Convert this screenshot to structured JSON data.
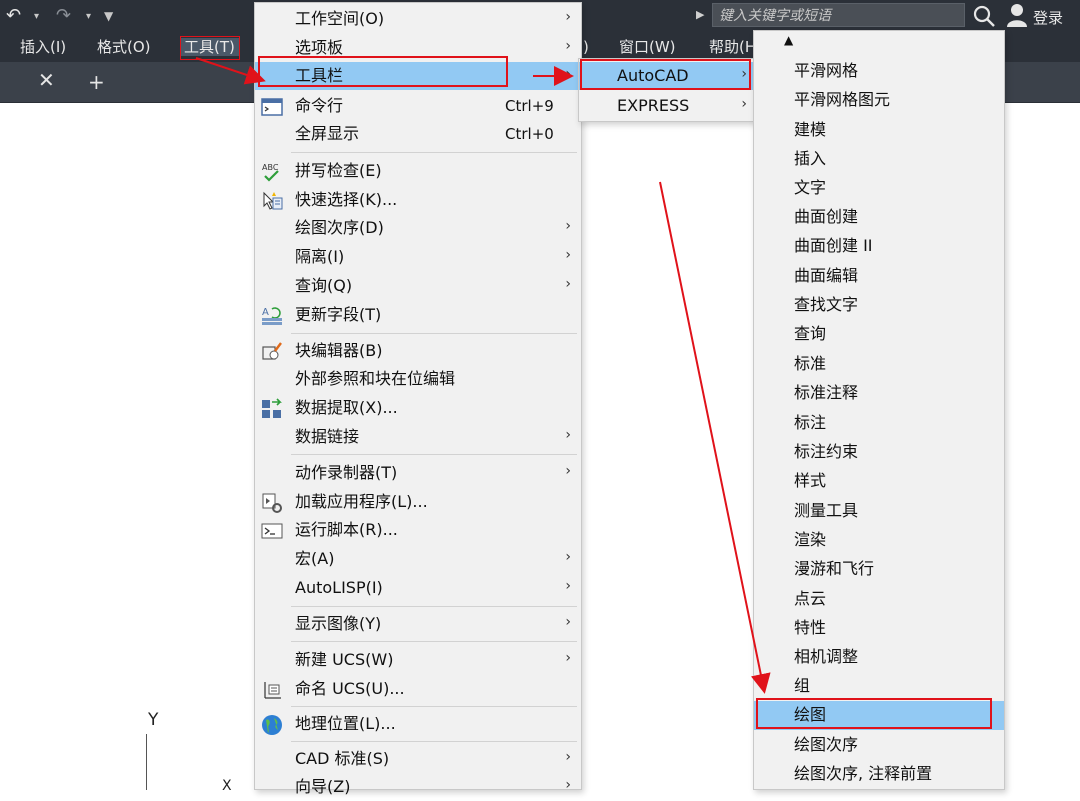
{
  "menubar": {
    "items": [
      "插入(I)",
      "格式(O)",
      "工具(T)",
      ")",
      "窗口(W)",
      "帮助(H"
    ]
  },
  "search": {
    "placeholder": "键入关键字或短语"
  },
  "login_label": "登录",
  "tools_menu": {
    "items": [
      {
        "label": "工作空间(O)",
        "submenu": true
      },
      {
        "label": "选项板",
        "submenu": true
      },
      {
        "label": "工具栏",
        "submenu": true
      },
      {
        "label": "命令行",
        "shortcut": "Ctrl+9"
      },
      {
        "label": "全屏显示",
        "shortcut": "Ctrl+0"
      },
      {
        "label": "拼写检查(E)"
      },
      {
        "label": "快速选择(K)..."
      },
      {
        "label": "绘图次序(D)",
        "submenu": true
      },
      {
        "label": "隔离(I)",
        "submenu": true
      },
      {
        "label": "查询(Q)",
        "submenu": true
      },
      {
        "label": "更新字段(T)"
      },
      {
        "label": "块编辑器(B)"
      },
      {
        "label": "外部参照和块在位编辑",
        "submenu": true
      },
      {
        "label": "数据提取(X)..."
      },
      {
        "label": "数据链接",
        "submenu": true
      },
      {
        "label": "动作录制器(T)",
        "submenu": true
      },
      {
        "label": "加载应用程序(L)..."
      },
      {
        "label": "运行脚本(R)..."
      },
      {
        "label": "宏(A)",
        "submenu": true
      },
      {
        "label": "AutoLISP(I)",
        "submenu": true
      },
      {
        "label": "显示图像(Y)",
        "submenu": true
      },
      {
        "label": "新建 UCS(W)",
        "submenu": true
      },
      {
        "label": "命名 UCS(U)..."
      },
      {
        "label": "地理位置(L)..."
      },
      {
        "label": "CAD 标准(S)",
        "submenu": true
      },
      {
        "label": "向导(Z)",
        "submenu": true
      }
    ]
  },
  "toolbar_submenu": {
    "items": [
      "AutoCAD",
      "EXPRESS"
    ]
  },
  "autocad_list": {
    "items": [
      "平滑网格",
      "平滑网格图元",
      "建模",
      "插入",
      "文字",
      "曲面创建",
      "曲面创建 II",
      "曲面编辑",
      "查找文字",
      "查询",
      "标准",
      "标准注释",
      "标注",
      "标注约束",
      "样式",
      "测量工具",
      "渲染",
      "漫游和飞行",
      "点云",
      "特性",
      "相机调整",
      "组",
      "绘图",
      "绘图次序",
      "绘图次序, 注释前置"
    ]
  },
  "ucs": {
    "y_label": "Y",
    "x_label": "X"
  },
  "colors": {
    "highlight": "#92c9f3",
    "annotation": "#e0121a",
    "dark_ui": "#2b3038"
  }
}
